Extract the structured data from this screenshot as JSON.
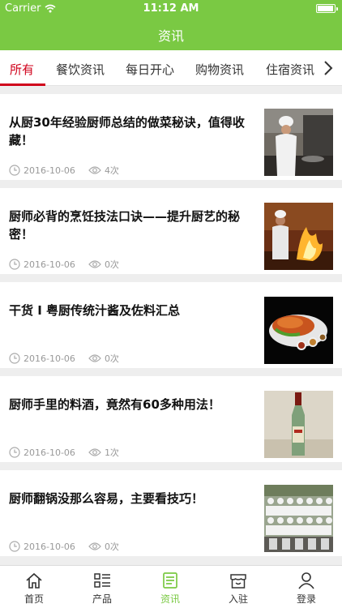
{
  "status_bar": {
    "carrier": "Carrier",
    "time": "11:12 AM"
  },
  "header": {
    "title": "资讯"
  },
  "tabs": [
    {
      "label": "所有",
      "active": true
    },
    {
      "label": "餐饮资讯",
      "active": false
    },
    {
      "label": "每日开心",
      "active": false
    },
    {
      "label": "购物资讯",
      "active": false
    },
    {
      "label": "住宿资讯",
      "active": false
    }
  ],
  "articles": [
    {
      "title": "从厨30年经验厨师总结的做菜秘诀，值得收藏！",
      "date": "2016-10-06",
      "views": "4次",
      "image": "chef-cooking-photo"
    },
    {
      "title": "厨师必背的烹饪技法口诀——提升厨艺的秘密！",
      "date": "2016-10-06",
      "views": "0次",
      "image": "flambe-wok-photo"
    },
    {
      "title": "干货 I 粤厨传统汁酱及佐料汇总",
      "date": "2016-10-06",
      "views": "0次",
      "image": "roast-pig-sauces-photo"
    },
    {
      "title": "厨师手里的料酒，竟然有60多种用法！",
      "date": "2016-10-06",
      "views": "1次",
      "image": "cooking-wine-bottle-photo"
    },
    {
      "title": "厨师翻锅没那么容易，主要看技巧！",
      "date": "2016-10-06",
      "views": "0次",
      "image": "chef-group-photo"
    }
  ],
  "bottom_nav": [
    {
      "label": "首页",
      "icon": "home-icon",
      "active": false
    },
    {
      "label": "产品",
      "icon": "product-grid-icon",
      "active": false
    },
    {
      "label": "资讯",
      "icon": "news-icon",
      "active": true
    },
    {
      "label": "入驻",
      "icon": "store-icon",
      "active": false
    },
    {
      "label": "登录",
      "icon": "user-icon",
      "active": false
    }
  ],
  "colors": {
    "brand_green": "#7ac943",
    "tab_active_red": "#d0021b",
    "meta_gray": "#999999"
  }
}
